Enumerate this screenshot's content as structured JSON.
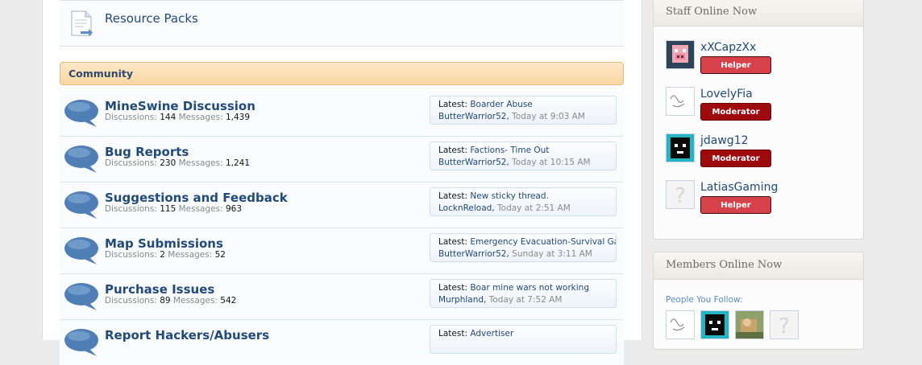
{
  "forum": {
    "top_node": {
      "title": "Resource Packs"
    },
    "category": {
      "title": "Community"
    },
    "stats_labels": {
      "discussions": "Discussions:",
      "messages": "Messages:"
    },
    "latest_label": "Latest:",
    "nodes": [
      {
        "title": "MineSwine Discussion",
        "discussions": "144",
        "messages": "1,439",
        "latest_title": "Boarder Abuse",
        "latest_user": "ButterWarrior52",
        "latest_time": "Today at 9:03 AM"
      },
      {
        "title": "Bug Reports",
        "discussions": "230",
        "messages": "1,241",
        "latest_title": "Factions- Time Out",
        "latest_user": "ButterWarrior52",
        "latest_time": "Today at 10:15 AM"
      },
      {
        "title": "Suggestions and Feedback",
        "discussions": "115",
        "messages": "963",
        "latest_title": "New sticky thread.",
        "latest_user": "LocknReload",
        "latest_time": "Today at 2:51 AM"
      },
      {
        "title": "Map Submissions",
        "discussions": "2",
        "messages": "52",
        "latest_title": "Emergency Evacuation-Survival Gam",
        "latest_user": "ButterWarrior52",
        "latest_time": "Sunday at 3:11 AM"
      },
      {
        "title": "Purchase Issues",
        "discussions": "89",
        "messages": "542",
        "latest_title": "Boar mine wars not working",
        "latest_user": "Murphland",
        "latest_time": "Today at 7:52 AM"
      },
      {
        "title": "Report Hackers/Abusers",
        "latest_title": "Advertiser"
      }
    ]
  },
  "sidebar": {
    "staff": {
      "title": "Staff Online Now",
      "members": [
        {
          "name": "xXCapzXx",
          "rank": "Helper"
        },
        {
          "name": "LovelyFia",
          "rank": "Moderator"
        },
        {
          "name": "jdawg12",
          "rank": "Moderator"
        },
        {
          "name": "LatiasGaming",
          "rank": "Helper"
        }
      ]
    },
    "members_online": {
      "title": "Members Online Now",
      "follow_label": "People You Follow:"
    }
  },
  "colors": {
    "helper": "#d6414a",
    "moderator": "#9e0b0f",
    "link": "#1f4a7a",
    "category": "#f8d6a2"
  },
  "icons": {
    "node_icon": "speech-bubble-icon",
    "resource_icon": "document-icon",
    "no_avatar": "question-mark-icon"
  }
}
